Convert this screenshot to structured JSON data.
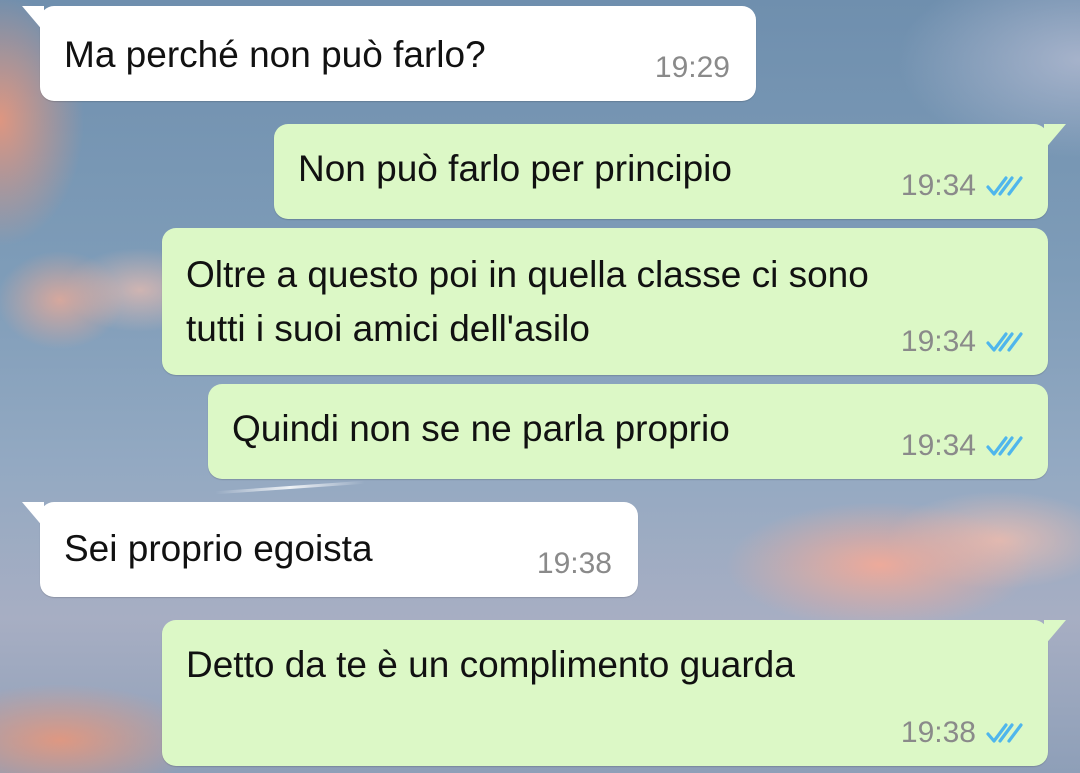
{
  "chat": {
    "messages": [
      {
        "direction": "incoming",
        "text": "Ma perché non può farlo?",
        "time": "19:29"
      },
      {
        "direction": "outgoing",
        "text": "Non può farlo per principio",
        "time": "19:34",
        "status_icon": "double-check-read-icon"
      },
      {
        "direction": "outgoing",
        "text": "Oltre a questo poi in quella classe ci sono\ntutti i suoi amici  dell'asilo",
        "time": "19:34",
        "status_icon": "double-check-read-icon"
      },
      {
        "direction": "outgoing",
        "text": "Quindi non se ne parla proprio",
        "time": "19:34",
        "status_icon": "double-check-read-icon"
      },
      {
        "direction": "incoming",
        "text": "Sei proprio egoista",
        "time": "19:38"
      },
      {
        "direction": "outgoing",
        "text": "Detto da te è un complimento guarda",
        "time": "19:38",
        "status_icon": "double-check-read-icon"
      }
    ]
  },
  "colors": {
    "incoming_bubble": "#ffffff",
    "outgoing_bubble": "#dcf8c6",
    "timestamp": "#8a8a8a",
    "read_ticks": "#4fb6ec"
  }
}
